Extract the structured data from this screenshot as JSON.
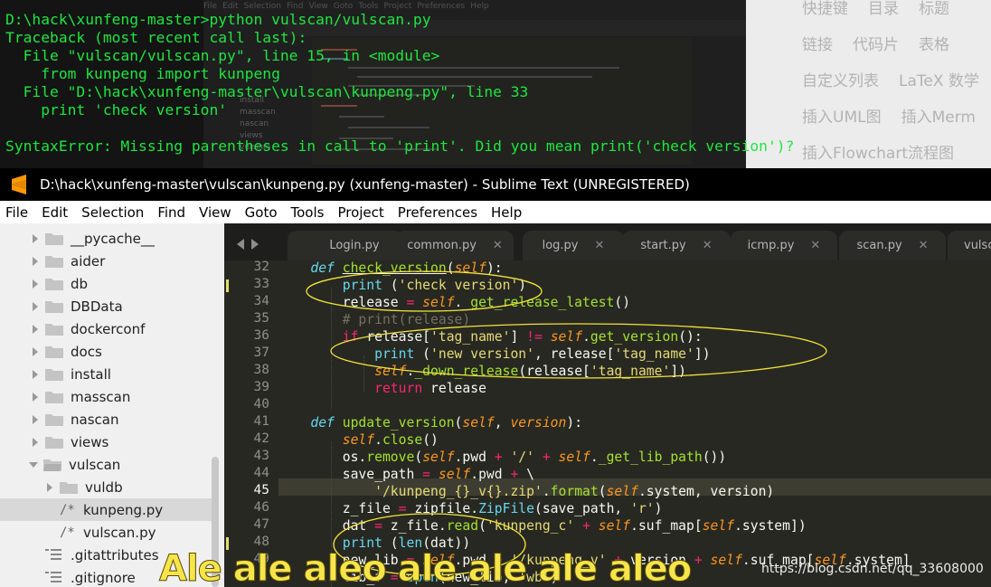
{
  "terminal": {
    "lines": [
      "D:\\hack\\xunfeng-master>python vulscan/vulscan.py",
      "Traceback (most recent call last):",
      "  File \"vulscan/vulscan.py\", line 15, in <module>",
      "    from kunpeng import kunpeng",
      "  File \"D:\\hack\\xunfeng-master\\vulscan\\kunpeng.py\", line 33",
      "    print 'check version'",
      "",
      "SyntaxError: Missing parentheses in call to 'print'. Did you mean print('check version')?"
    ]
  },
  "blog_toolbar": {
    "rows": [
      [
        "快捷键",
        "目录",
        "标题"
      ],
      [
        "链接",
        "代码片",
        "表格"
      ],
      [
        "自定义列表",
        "LaTeX 数学"
      ],
      [
        "插入UML图",
        "插入Merm"
      ],
      [
        "插入Flowchart流程图"
      ]
    ]
  },
  "window": {
    "title": "D:\\hack\\xunfeng-master\\vulscan\\kunpeng.py (xunfeng-master) - Sublime Text (UNREGISTERED)",
    "app_icon": "sublime-text-icon",
    "accent": "#ff9800"
  },
  "menu": [
    "File",
    "Edit",
    "Selection",
    "Find",
    "View",
    "Goto",
    "Tools",
    "Project",
    "Preferences",
    "Help"
  ],
  "sidebar": {
    "items": [
      {
        "label": "__pycache__",
        "type": "folder",
        "expanded": false,
        "depth": 0
      },
      {
        "label": "aider",
        "type": "folder",
        "expanded": false,
        "depth": 0
      },
      {
        "label": "db",
        "type": "folder",
        "expanded": false,
        "depth": 0
      },
      {
        "label": "DBData",
        "type": "folder",
        "expanded": false,
        "depth": 0
      },
      {
        "label": "dockerconf",
        "type": "folder",
        "expanded": false,
        "depth": 0
      },
      {
        "label": "docs",
        "type": "folder",
        "expanded": false,
        "depth": 0
      },
      {
        "label": "install",
        "type": "folder",
        "expanded": false,
        "depth": 0
      },
      {
        "label": "masscan",
        "type": "folder",
        "expanded": false,
        "depth": 0
      },
      {
        "label": "nascan",
        "type": "folder",
        "expanded": false,
        "depth": 0
      },
      {
        "label": "views",
        "type": "folder",
        "expanded": false,
        "depth": 0
      },
      {
        "label": "vulscan",
        "type": "folder",
        "expanded": true,
        "depth": 0
      },
      {
        "label": "vuldb",
        "type": "folder",
        "expanded": false,
        "depth": 1
      },
      {
        "label": "kunpeng.py",
        "type": "file",
        "prefix": "/*",
        "selected": true,
        "depth": 1
      },
      {
        "label": "vulscan.py",
        "type": "file",
        "prefix": "/*",
        "depth": 1
      },
      {
        "label": ".gitattributes",
        "type": "doc",
        "depth": 0
      },
      {
        "label": ".gitignore",
        "type": "doc",
        "depth": 0
      }
    ]
  },
  "tabs": [
    {
      "label": "Login.py",
      "closable": false
    },
    {
      "label": "common.py",
      "closable": true
    },
    {
      "label": "log.py",
      "closable": true
    },
    {
      "label": "start.py",
      "closable": true
    },
    {
      "label": "icmp.py",
      "closable": true
    },
    {
      "label": "scan.py",
      "closable": true
    },
    {
      "label": "vulsc",
      "closable": false
    }
  ],
  "editor": {
    "line_numbers": [
      "32",
      "33",
      "34",
      "35",
      "36",
      "37",
      "38",
      "39",
      "40",
      "41",
      "42",
      "43",
      "44",
      "45",
      "46",
      "47",
      "48",
      "49"
    ],
    "active_line": "45",
    "modified_lines": [
      "33",
      "48"
    ]
  },
  "subtitle": "Ale ale aleo ale ale ale aleo",
  "watermark": "https://blog.csdn.net/qq_33608000"
}
